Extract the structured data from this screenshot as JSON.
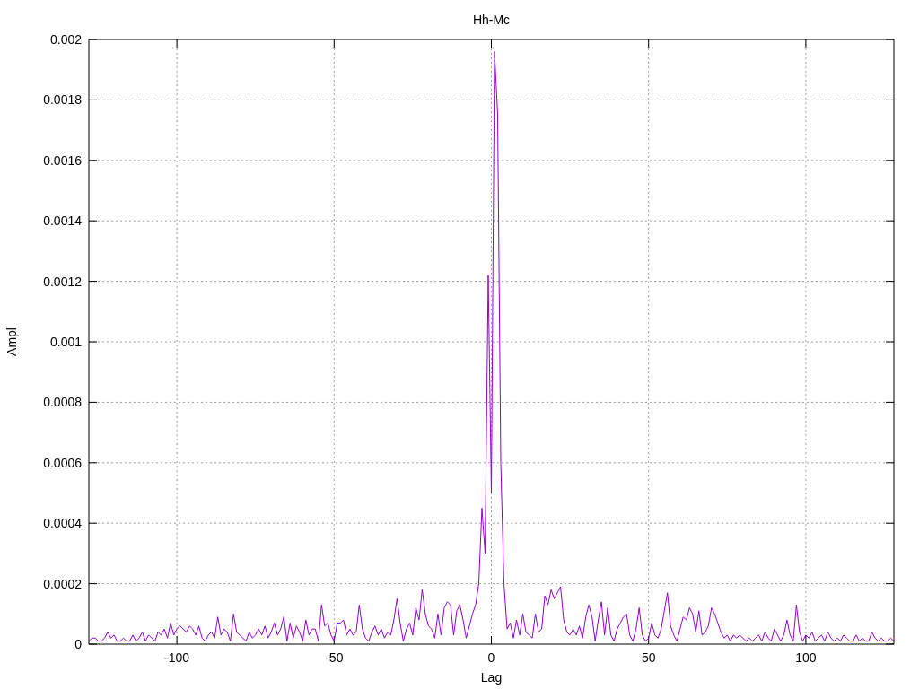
{
  "chart": {
    "chart_data": {
      "type": "line",
      "grid": true,
      "title": "Hh-Mc",
      "xlabel": "Lag",
      "ylabel": "Ampl",
      "xlim": [
        -128,
        128
      ],
      "ylim": [
        0,
        0.002
      ],
      "xticks": [
        -100,
        -50,
        0,
        50,
        100
      ],
      "yticks": [
        0,
        0.0002,
        0.0004,
        0.0006,
        0.0008,
        0.001,
        0.0012,
        0.0014,
        0.0016,
        0.0018,
        0.002
      ],
      "x": [
        -128,
        -127,
        -126,
        -125,
        -124,
        -123,
        -122,
        -121,
        -120,
        -119,
        -118,
        -117,
        -116,
        -115,
        -114,
        -113,
        -112,
        -111,
        -110,
        -109,
        -108,
        -107,
        -106,
        -105,
        -104,
        -103,
        -102,
        -101,
        -100,
        -99,
        -98,
        -97,
        -96,
        -95,
        -94,
        -93,
        -92,
        -91,
        -90,
        -89,
        -88,
        -87,
        -86,
        -85,
        -84,
        -83,
        -82,
        -81,
        -80,
        -79,
        -78,
        -77,
        -76,
        -75,
        -74,
        -73,
        -72,
        -71,
        -70,
        -69,
        -68,
        -67,
        -66,
        -65,
        -64,
        -63,
        -62,
        -61,
        -60,
        -59,
        -58,
        -57,
        -56,
        -55,
        -54,
        -53,
        -52,
        -51,
        -50,
        -49,
        -48,
        -47,
        -46,
        -45,
        -44,
        -43,
        -42,
        -41,
        -40,
        -39,
        -38,
        -37,
        -36,
        -35,
        -34,
        -33,
        -32,
        -31,
        -30,
        -29,
        -28,
        -27,
        -26,
        -25,
        -24,
        -23,
        -22,
        -21,
        -20,
        -19,
        -18,
        -17,
        -16,
        -15,
        -14,
        -13,
        -12,
        -11,
        -10,
        -9,
        -8,
        -7,
        -6,
        -5,
        -4,
        -3,
        -2,
        -1,
        0,
        1,
        2,
        3,
        4,
        5,
        6,
        7,
        8,
        9,
        10,
        11,
        12,
        13,
        14,
        15,
        16,
        17,
        18,
        19,
        20,
        21,
        22,
        23,
        24,
        25,
        26,
        27,
        28,
        29,
        30,
        31,
        32,
        33,
        34,
        35,
        36,
        37,
        38,
        39,
        40,
        41,
        42,
        43,
        44,
        45,
        46,
        47,
        48,
        49,
        50,
        51,
        52,
        53,
        54,
        55,
        56,
        57,
        58,
        59,
        60,
        61,
        62,
        63,
        64,
        65,
        66,
        67,
        68,
        69,
        70,
        71,
        72,
        73,
        74,
        75,
        76,
        77,
        78,
        79,
        80,
        81,
        82,
        83,
        84,
        85,
        86,
        87,
        88,
        89,
        90,
        91,
        92,
        93,
        94,
        95,
        96,
        97,
        98,
        99,
        100,
        101,
        102,
        103,
        104,
        105,
        106,
        107,
        108,
        109,
        110,
        111,
        112,
        113,
        114,
        115,
        116,
        117,
        118,
        119,
        120,
        121,
        122,
        123,
        124,
        125,
        126,
        127,
        128
      ],
      "series": [
        {
          "color": "#9400d3",
          "values": [
            1e-05,
            2e-05,
            2e-05,
            1e-05,
            1e-05,
            2e-05,
            4e-05,
            2e-05,
            3e-05,
            1e-05,
            1e-05,
            2e-05,
            1e-05,
            1e-05,
            3e-05,
            1e-05,
            2e-05,
            4e-05,
            1e-05,
            3e-05,
            2e-05,
            1e-05,
            4e-05,
            3e-05,
            5e-05,
            2e-05,
            7e-05,
            3e-05,
            5e-05,
            6e-05,
            5e-05,
            4e-05,
            6e-05,
            5e-05,
            3e-05,
            6e-05,
            2e-05,
            1e-05,
            3e-05,
            4e-05,
            2e-05,
            9e-05,
            3e-05,
            5e-05,
            4e-05,
            1e-05,
            0.0001,
            4e-05,
            3e-05,
            2e-05,
            1e-05,
            4e-05,
            2e-05,
            3e-05,
            5e-05,
            3e-05,
            6e-05,
            2e-05,
            4e-05,
            7e-05,
            3e-05,
            5e-05,
            9e-05,
            1e-05,
            7e-05,
            2e-05,
            6e-05,
            4e-05,
            1e-05,
            8e-05,
            3e-05,
            5e-05,
            5e-05,
            1e-05,
            0.00013,
            6e-05,
            7e-05,
            3e-05,
            1e-05,
            7e-05,
            7e-05,
            8e-05,
            3e-05,
            5e-05,
            3e-05,
            4e-05,
            0.00013,
            5e-05,
            2e-05,
            1e-05,
            4e-05,
            6e-05,
            3e-05,
            5e-05,
            2e-05,
            4e-05,
            3e-05,
            8e-05,
            0.00015,
            7e-05,
            1e-05,
            5e-05,
            7e-05,
            3e-05,
            0.00012,
            8e-05,
            0.00018,
            0.0001,
            6e-05,
            5e-05,
            2e-05,
            0.0001,
            3e-05,
            0.00012,
            0.00014,
            0.00013,
            3e-05,
            0.00011,
            0.00013,
            8e-05,
            2e-05,
            6e-05,
            0.0001,
            0.00013,
            0.0002,
            0.00045,
            0.0003,
            0.00122,
            0.0005,
            0.00196,
            0.00175,
            0.0006,
            0.0002,
            5e-05,
            7e-05,
            2e-05,
            8e-05,
            3e-05,
            0.0001,
            4e-05,
            3e-05,
            2e-05,
            0.0001,
            4e-05,
            5e-05,
            0.00016,
            0.00013,
            0.00018,
            0.00015,
            0.00017,
            0.00019,
            8e-05,
            4e-05,
            3e-05,
            5e-05,
            3e-05,
            6e-05,
            2e-05,
            9e-05,
            0.00013,
            9e-05,
            1e-05,
            8e-05,
            0.00014,
            3e-05,
            0.00012,
            3e-05,
            1e-05,
            5e-05,
            7e-05,
            9e-05,
            0.0001,
            3e-05,
            1e-05,
            5e-05,
            0.00012,
            3e-05,
            1e-05,
            2e-05,
            7e-05,
            3e-05,
            2e-05,
            5e-05,
            0.00011,
            0.00017,
            6e-05,
            3e-05,
            1e-05,
            5e-05,
            9e-05,
            8e-05,
            0.00012,
            0.0001,
            4e-05,
            0.00011,
            3e-05,
            4e-05,
            6e-05,
            0.00012,
            0.0001,
            7e-05,
            4e-05,
            2e-05,
            3e-05,
            1e-05,
            3e-05,
            2e-05,
            3e-05,
            2e-05,
            1e-05,
            2e-05,
            1e-05,
            2e-05,
            3e-05,
            1e-05,
            4e-05,
            2e-05,
            1e-05,
            5e-05,
            3e-05,
            1e-05,
            3e-05,
            8e-05,
            3e-05,
            1e-05,
            0.00013,
            4e-05,
            1e-05,
            3e-05,
            2e-05,
            4e-05,
            1e-05,
            2e-05,
            3e-05,
            1e-05,
            4e-05,
            2e-05,
            1e-05,
            2e-05,
            1e-05,
            3e-05,
            2e-05,
            1e-05,
            1e-05,
            3e-05,
            1e-05,
            2e-05,
            1e-05,
            1e-05,
            4e-05,
            2e-05,
            1e-05,
            2e-05,
            1e-05,
            1e-05,
            2e-05,
            1e-05
          ]
        }
      ]
    }
  }
}
